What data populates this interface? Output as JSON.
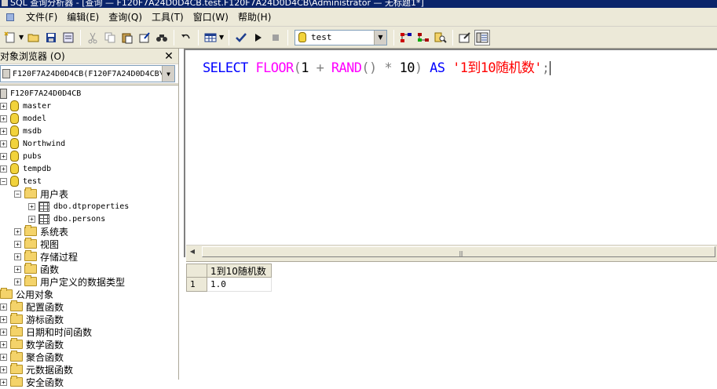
{
  "window": {
    "title": "SQL 查询分析器 - [查询 — F120F7A24D0D4CB.test.F120F7A24D0D4CB\\Administrator — 无标题1*]"
  },
  "menu": [
    "文件(F)",
    "编辑(E)",
    "查询(Q)",
    "工具(T)",
    "窗口(W)",
    "帮助(H)"
  ],
  "toolbar": {
    "database": "test"
  },
  "object_browser": {
    "title": "对象浏览器 (O)",
    "server_combo": "F120F7A24D0D4CB(F120F7A24D0D4CB\\",
    "server": "F120F7A24D0D4CB",
    "databases": [
      "master",
      "model",
      "msdb",
      "Northwind",
      "pubs",
      "tempdb",
      "test"
    ],
    "test_children": {
      "user_tables": "用户表",
      "tables": [
        "dbo.dtproperties",
        "dbo.persons"
      ],
      "system_tables": "系统表",
      "views": "视图",
      "procs": "存储过程",
      "functions": "函数",
      "udt": "用户定义的数据类型"
    },
    "public_objects": "公用对象",
    "function_groups": [
      "配置函数",
      "游标函数",
      "日期和时间函数",
      "数学函数",
      "聚合函数",
      "元数据函数",
      "安全函数"
    ]
  },
  "editor": {
    "tokens": {
      "select": "SELECT",
      "floor": "FLOOR",
      "lparen1": "(",
      "one": "1",
      "plus": "+",
      "rand": "RAND",
      "parens": "()",
      "star": "*",
      "ten": "10",
      "rparen": ")",
      "as": "AS",
      "alias": "'1到10随机数'",
      "semi": ";"
    }
  },
  "results": {
    "columns": [
      "1到10随机数"
    ],
    "rows": [
      {
        "num": "1",
        "cells": [
          "1.0"
        ]
      }
    ]
  },
  "colors": {
    "keyword": "#0000ff",
    "function": "#ff00ff",
    "operator": "#808080",
    "string": "#ff0000"
  }
}
